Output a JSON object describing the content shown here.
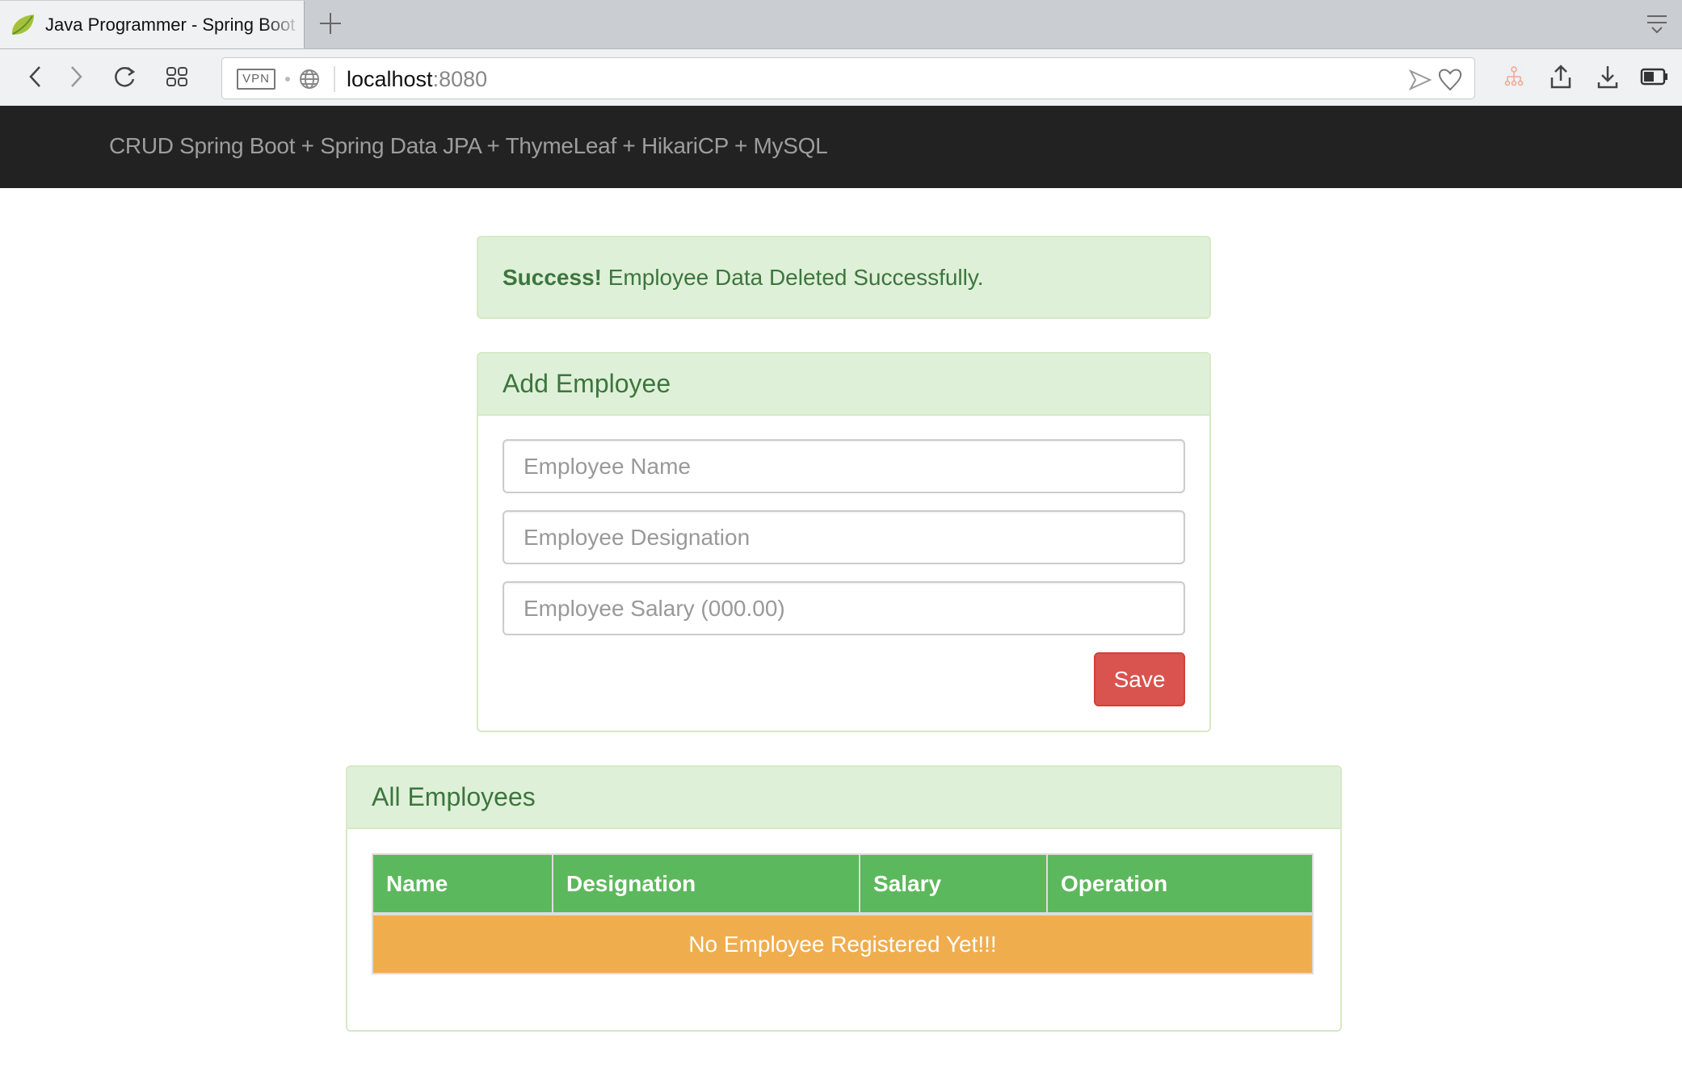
{
  "browser": {
    "tab_title": "Java Programmer - Spring Boot",
    "url_host": "localhost",
    "url_port": ":8080",
    "vpn_label": "VPN",
    "icons": [
      "spring-leaf-icon",
      "new-tab-icon",
      "tab-menu-icon",
      "back-icon",
      "forward-icon",
      "reload-icon",
      "tab-grid-icon",
      "globe-icon",
      "send-icon",
      "heart-icon",
      "sitemap-extension-icon",
      "share-icon",
      "download-icon",
      "battery-icon"
    ]
  },
  "navbar": {
    "brand": "CRUD Spring Boot + Spring Data JPA + ThymeLeaf + HikariCP + MySQL"
  },
  "alert": {
    "strong": "Success!",
    "message": " Employee Data Deleted Successfully."
  },
  "add_panel": {
    "title": "Add Employee",
    "name_placeholder": "Employee Name",
    "designation_placeholder": "Employee Designation",
    "salary_placeholder": "Employee Salary (000.00)",
    "save_label": "Save"
  },
  "list_panel": {
    "title": "All Employees",
    "columns": [
      "Name",
      "Designation",
      "Salary",
      "Operation"
    ],
    "empty_message": "No Employee Registered Yet!!!"
  },
  "colors": {
    "success_bg": "#dff0d8",
    "success_text": "#3c763d",
    "table_head": "#5cb85c",
    "warning": "#f0ad4e",
    "danger": "#d9534f",
    "navbar": "#222222"
  }
}
